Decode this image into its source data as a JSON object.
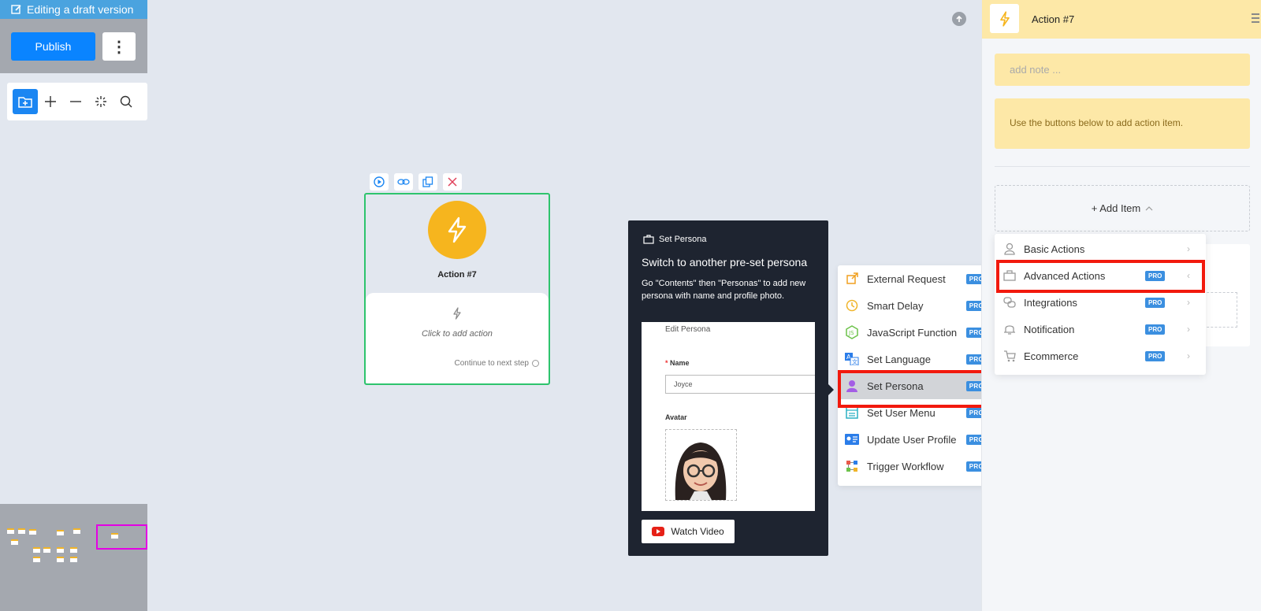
{
  "banner": {
    "text": "Editing a draft version"
  },
  "publish": {
    "label": "Publish",
    "more": "⋮"
  },
  "toolbar": {
    "tools": [
      "folder-add-icon",
      "plus-icon",
      "minus-icon",
      "magic-icon",
      "search-icon"
    ]
  },
  "node": {
    "title": "Action #7",
    "click_text": "Click to add action",
    "next_text": "Continue to next step"
  },
  "tooltip": {
    "header": "Set Persona",
    "title": "Switch to another pre-set persona",
    "description": "Go \"Contents\" then \"Personas\" to add new persona with name and profile photo.",
    "shot": {
      "heading": "Edit Persona",
      "name_label": "Name",
      "name_value": "Joyce",
      "avatar_label": "Avatar"
    },
    "video_label": "Watch Video"
  },
  "submenu": {
    "items": [
      {
        "label": "External Request",
        "icon": "external-link-icon",
        "color": "#f0a020"
      },
      {
        "label": "Smart Delay",
        "icon": "clock-icon",
        "color": "#f0b429"
      },
      {
        "label": "JavaScript Function",
        "icon": "nodejs-icon",
        "color": "#6cc24a"
      },
      {
        "label": "Set Language",
        "icon": "translate-icon",
        "color": "#2b7de9"
      },
      {
        "label": "Set Persona",
        "icon": "persona-icon",
        "color": "#a45ee5"
      },
      {
        "label": "Set User Menu",
        "icon": "menu-icon",
        "color": "#2bb0c4"
      },
      {
        "label": "Update User Profile",
        "icon": "id-card-icon",
        "color": "#2b7de9"
      },
      {
        "label": "Trigger Workflow",
        "icon": "workflow-icon",
        "color": "#e8594a"
      }
    ],
    "pro": "PRO",
    "selected": "Set Persona"
  },
  "panel": {
    "title": "Action #7",
    "note_placeholder": "add note ...",
    "info": "Use the buttons below to add action item.",
    "add_item": "+ Add Item"
  },
  "dropmenu": {
    "items": [
      {
        "label": "Basic Actions",
        "icon": "user-icon",
        "pro": false,
        "chevron": "›"
      },
      {
        "label": "Advanced Actions",
        "icon": "briefcase-icon",
        "pro": true,
        "chevron": "‹"
      },
      {
        "label": "Integrations",
        "icon": "link-icon",
        "pro": true,
        "chevron": "›"
      },
      {
        "label": "Notification",
        "icon": "bell-icon",
        "pro": true,
        "chevron": "›"
      },
      {
        "label": "Ecommerce",
        "icon": "cart-icon",
        "pro": true,
        "chevron": "›"
      }
    ],
    "pro": "PRO"
  },
  "colors": {
    "accent": "#0a84ff",
    "node_border": "#2ec46d",
    "bolt": "#f6b51e",
    "highlight": "#f2190d"
  }
}
